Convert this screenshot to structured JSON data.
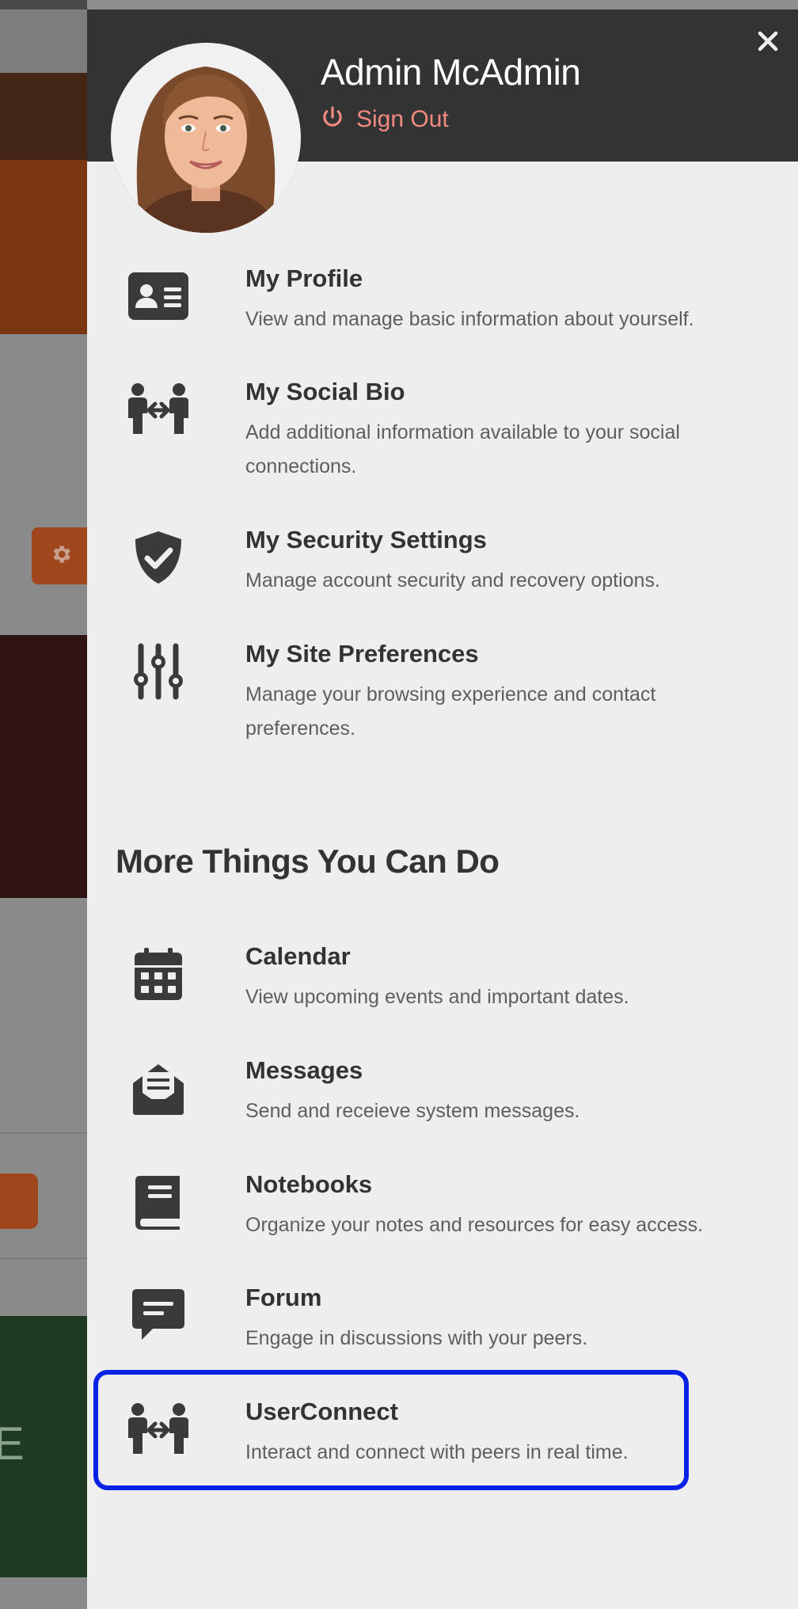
{
  "user": {
    "name": "Admin McAdmin",
    "sign_out_label": "Sign Out",
    "avatar": "avatar-photo"
  },
  "close": {
    "icon": "close-icon"
  },
  "account_items": [
    {
      "icon": "id-card-icon",
      "title": "My Profile",
      "description": "View and manage basic information about yourself."
    },
    {
      "icon": "users-connect-icon",
      "title": "My Social Bio",
      "description": "Add additional information available to your social connections."
    },
    {
      "icon": "shield-check-icon",
      "title": "My Security Settings",
      "description": "Manage account security and recovery options."
    },
    {
      "icon": "sliders-icon",
      "title": "My Site Preferences",
      "description": "Manage your browsing experience and contact preferences."
    }
  ],
  "more_section": {
    "title": "More Things You Can Do",
    "items": [
      {
        "icon": "calendar-icon",
        "title": "Calendar",
        "description": "View upcoming events and important dates."
      },
      {
        "icon": "envelope-open-icon",
        "title": "Messages",
        "description": "Send and receieve system messages."
      },
      {
        "icon": "book-icon",
        "title": "Notebooks",
        "description": "Organize your notes and resources for easy access."
      },
      {
        "icon": "message-icon",
        "title": "Forum",
        "description": "Engage in discussions with your peers."
      },
      {
        "icon": "users-connect-icon",
        "title": "UserConnect",
        "description": "Interact and connect with peers in real time."
      }
    ]
  },
  "background_page": {
    "letter": "E",
    "gear_icon": "gear-icon"
  },
  "colors": {
    "header_bg": "#333333",
    "drawer_bg": "#eeeeee",
    "sign_out": "#f28a82",
    "highlight": "#0a22e6",
    "accent_orange": "#a0461d"
  }
}
